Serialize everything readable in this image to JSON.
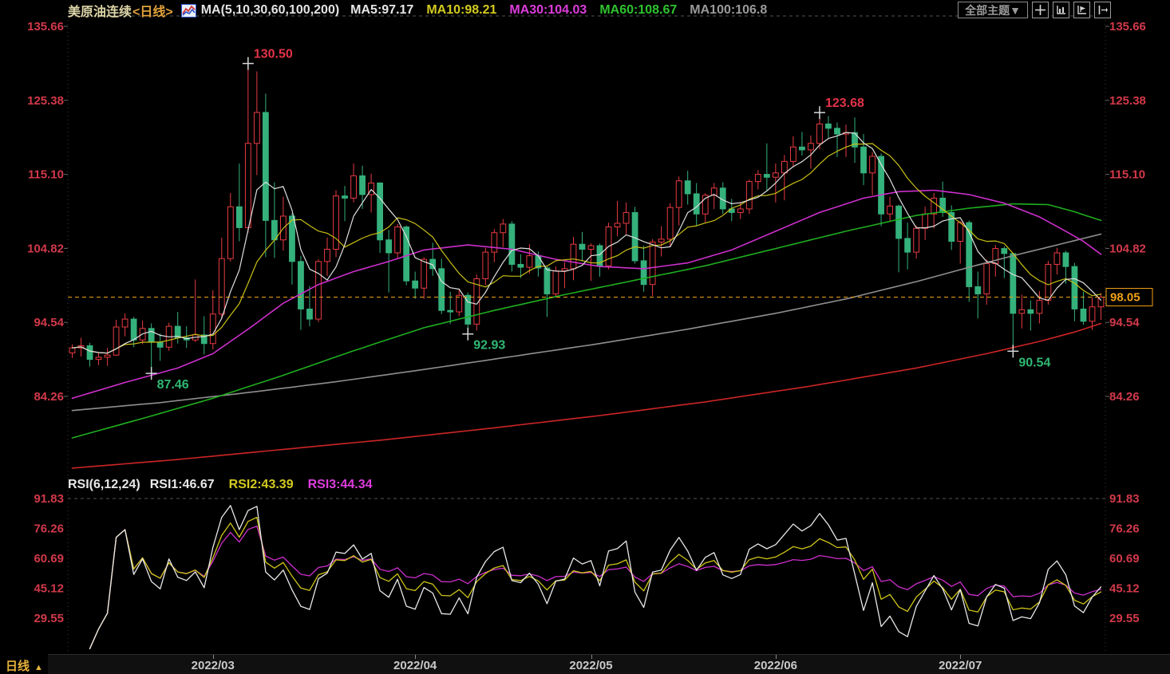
{
  "header": {
    "symbol": "美原油连续",
    "period": "<日线>",
    "ma_settings": "MA(5,10,30,60,100,200)",
    "ma_values": [
      {
        "key": "ma5",
        "label": "MA5:97.17",
        "color": "#e8e8e8"
      },
      {
        "key": "ma10",
        "label": "MA10:98.21",
        "color": "#d3cb21"
      },
      {
        "key": "ma30",
        "label": "MA30:104.03",
        "color": "#dd3ddd"
      },
      {
        "key": "ma60",
        "label": "MA60:108.67",
        "color": "#2fc32f"
      },
      {
        "key": "ma100",
        "label": "MA100:106.8",
        "color": "#9a9a9a"
      }
    ],
    "theme_button_label": "全部主题▼",
    "toolbar_icons": [
      "crosshair",
      "axis-scale",
      "axis-flag",
      "pan-right"
    ]
  },
  "rsi_header": {
    "title": "RSI(6,12,24)",
    "values": [
      {
        "key": "rsi1",
        "label": "RSI1:46.67",
        "color": "#e8e8e8"
      },
      {
        "key": "rsi2",
        "label": "RSI2:43.39",
        "color": "#d3cb21"
      },
      {
        "key": "rsi3",
        "label": "RSI3:44.34",
        "color": "#dd3ddd"
      }
    ]
  },
  "time_axis": {
    "period_label": "日线",
    "arrow": "▲"
  },
  "chart_data": {
    "type": "candlestick",
    "title": "美原油连续 日线",
    "price_axis_ticks": [
      135.66,
      125.38,
      115.1,
      104.82,
      94.54,
      84.26
    ],
    "rsi_axis_ticks": [
      91.83,
      76.26,
      60.69,
      45.12,
      29.55
    ],
    "last_price": 98.05,
    "months": [
      {
        "index": 16,
        "label": "2022/03"
      },
      {
        "index": 39,
        "label": "2022/04"
      },
      {
        "index": 59,
        "label": "2022/05"
      },
      {
        "index": 80,
        "label": "2022/06"
      },
      {
        "index": 101,
        "label": "2022/07"
      }
    ],
    "candles": [
      [
        90.3,
        91.5,
        89.6,
        91.0
      ],
      [
        91.0,
        92.4,
        89.8,
        91.3
      ],
      [
        91.3,
        91.7,
        88.4,
        89.4
      ],
      [
        89.4,
        90.4,
        88.6,
        89.7
      ],
      [
        89.7,
        91.0,
        88.5,
        90.0
      ],
      [
        90.0,
        94.9,
        89.9,
        93.9
      ],
      [
        93.9,
        95.8,
        92.6,
        95.0
      ],
      [
        95.0,
        95.3,
        91.1,
        92.1
      ],
      [
        92.1,
        94.8,
        91.5,
        93.7
      ],
      [
        93.7,
        94.4,
        87.46,
        91.8
      ],
      [
        91.8,
        93.0,
        89.2,
        91.1
      ],
      [
        91.1,
        94.5,
        90.6,
        94.0
      ],
      [
        94.0,
        96.0,
        91.6,
        92.4
      ],
      [
        92.4,
        94.0,
        91.0,
        92.1
      ],
      [
        92.1,
        100.5,
        91.8,
        92.8
      ],
      [
        92.8,
        95.4,
        90.1,
        91.6
      ],
      [
        91.6,
        99.0,
        90.8,
        95.7
      ],
      [
        95.7,
        106.3,
        95.0,
        103.4
      ],
      [
        103.4,
        112.5,
        103.0,
        110.6
      ],
      [
        110.6,
        116.6,
        105.8,
        107.7
      ],
      [
        107.7,
        130.5,
        107.0,
        119.4
      ],
      [
        119.4,
        129.4,
        115.0,
        123.7
      ],
      [
        123.7,
        126.3,
        103.6,
        108.7
      ],
      [
        108.7,
        114.0,
        103.5,
        106.0
      ],
      [
        106.0,
        112.0,
        104.5,
        109.3
      ],
      [
        109.3,
        109.7,
        99.8,
        103.0
      ],
      [
        103.0,
        103.8,
        93.5,
        96.4
      ],
      [
        96.4,
        99.6,
        94.0,
        95.0
      ],
      [
        95.0,
        103.3,
        94.6,
        103.0
      ],
      [
        103.0,
        106.3,
        101.0,
        104.7
      ],
      [
        104.7,
        112.9,
        103.6,
        112.1
      ],
      [
        112.1,
        113.5,
        108.6,
        111.8
      ],
      [
        111.8,
        116.6,
        111.2,
        114.9
      ],
      [
        114.9,
        116.3,
        110.3,
        112.3
      ],
      [
        112.3,
        115.2,
        109.8,
        113.9
      ],
      [
        113.9,
        114.0,
        104.2,
        106.0
      ],
      [
        106.0,
        107.4,
        98.7,
        104.2
      ],
      [
        104.2,
        108.2,
        103.5,
        107.8
      ],
      [
        107.8,
        108.0,
        99.7,
        100.3
      ],
      [
        100.3,
        101.6,
        97.8,
        99.3
      ],
      [
        99.3,
        103.6,
        97.8,
        103.3
      ],
      [
        103.3,
        105.6,
        101.0,
        102.0
      ],
      [
        102.0,
        103.4,
        95.7,
        96.2
      ],
      [
        96.2,
        98.8,
        94.3,
        96.0
      ],
      [
        96.0,
        99.1,
        95.4,
        98.3
      ],
      [
        98.3,
        98.7,
        92.93,
        94.3
      ],
      [
        94.3,
        101.2,
        93.4,
        100.6
      ],
      [
        100.6,
        104.9,
        99.7,
        104.3
      ],
      [
        104.3,
        107.5,
        102.9,
        107.0
      ],
      [
        107.0,
        108.9,
        105.0,
        108.2
      ],
      [
        108.2,
        108.6,
        101.6,
        102.6
      ],
      [
        102.6,
        104.0,
        100.7,
        102.2
      ],
      [
        102.2,
        105.4,
        101.3,
        103.8
      ],
      [
        103.8,
        104.4,
        100.9,
        102.1
      ],
      [
        102.1,
        102.3,
        95.3,
        98.5
      ],
      [
        98.5,
        102.3,
        98.0,
        101.7
      ],
      [
        101.7,
        102.9,
        99.3,
        102.0
      ],
      [
        102.0,
        106.4,
        100.4,
        105.4
      ],
      [
        105.4,
        107.1,
        103.0,
        104.7
      ],
      [
        104.7,
        105.5,
        100.3,
        105.2
      ],
      [
        105.2,
        105.5,
        100.9,
        102.4
      ],
      [
        102.4,
        108.4,
        101.9,
        107.8
      ],
      [
        107.8,
        111.4,
        106.5,
        108.3
      ],
      [
        108.3,
        111.2,
        106.8,
        109.8
      ],
      [
        109.8,
        110.6,
        102.7,
        103.1
      ],
      [
        103.1,
        105.2,
        98.8,
        99.8
      ],
      [
        99.8,
        106.1,
        98.2,
        105.7
      ],
      [
        105.7,
        107.9,
        103.7,
        106.1
      ],
      [
        106.1,
        111.1,
        105.1,
        110.5
      ],
      [
        110.5,
        114.8,
        108.0,
        114.2
      ],
      [
        114.2,
        115.6,
        110.9,
        112.4
      ],
      [
        112.4,
        113.9,
        107.9,
        109.6
      ],
      [
        109.6,
        112.5,
        108.4,
        112.2
      ],
      [
        112.2,
        113.9,
        110.3,
        113.2
      ],
      [
        113.2,
        114.0,
        109.6,
        110.3
      ],
      [
        110.3,
        111.7,
        108.6,
        109.8
      ],
      [
        109.8,
        111.3,
        108.9,
        110.3
      ],
      [
        110.3,
        114.4,
        109.6,
        114.1
      ],
      [
        114.1,
        115.7,
        113.0,
        115.1
      ],
      [
        115.1,
        119.4,
        112.9,
        114.7
      ],
      [
        114.7,
        116.6,
        111.2,
        115.3
      ],
      [
        115.3,
        117.8,
        111.5,
        116.9
      ],
      [
        116.9,
        120.4,
        116.1,
        118.9
      ],
      [
        118.9,
        121.0,
        117.7,
        118.5
      ],
      [
        118.5,
        120.5,
        115.9,
        119.4
      ],
      [
        119.4,
        123.68,
        118.6,
        122.1
      ],
      [
        122.1,
        123.2,
        120.2,
        121.5
      ],
      [
        121.5,
        122.3,
        117.5,
        120.7
      ],
      [
        120.7,
        122.0,
        117.5,
        120.9
      ],
      [
        120.9,
        123.0,
        116.7,
        118.9
      ],
      [
        118.9,
        120.7,
        113.6,
        115.3
      ],
      [
        115.3,
        118.2,
        112.2,
        117.6
      ],
      [
        117.6,
        118.0,
        107.9,
        109.6
      ],
      [
        109.6,
        112.0,
        108.5,
        110.7
      ],
      [
        110.7,
        110.9,
        101.5,
        106.2
      ],
      [
        106.2,
        108.4,
        101.9,
        104.3
      ],
      [
        104.3,
        108.0,
        103.4,
        107.6
      ],
      [
        107.6,
        110.6,
        106.0,
        109.6
      ],
      [
        109.6,
        112.5,
        107.6,
        111.8
      ],
      [
        111.8,
        114.1,
        109.2,
        109.8
      ],
      [
        109.8,
        110.8,
        104.6,
        105.8
      ],
      [
        105.8,
        108.6,
        102.7,
        108.4
      ],
      [
        108.4,
        108.7,
        97.4,
        99.5
      ],
      [
        99.5,
        101.6,
        95.1,
        98.5
      ],
      [
        98.5,
        103.3,
        97.0,
        102.7
      ],
      [
        102.7,
        105.3,
        100.9,
        104.8
      ],
      [
        104.8,
        105.1,
        100.7,
        104.1
      ],
      [
        104.1,
        104.2,
        90.54,
        95.8
      ],
      [
        95.8,
        98.4,
        93.7,
        96.3
      ],
      [
        96.3,
        97.6,
        93.4,
        95.8
      ],
      [
        95.8,
        98.9,
        94.4,
        97.6
      ],
      [
        97.6,
        103.1,
        97.0,
        102.6
      ],
      [
        102.6,
        104.9,
        101.2,
        104.2
      ],
      [
        104.2,
        104.5,
        99.9,
        102.3
      ],
      [
        102.3,
        102.8,
        94.7,
        96.4
      ],
      [
        96.4,
        98.8,
        94.2,
        94.7
      ],
      [
        94.7,
        98.0,
        93.5,
        96.7
      ],
      [
        96.7,
        98.6,
        94.9,
        98.05
      ]
    ],
    "computed_ma": [
      {
        "period": 5,
        "color": "#e0e0e0"
      },
      {
        "period": 10,
        "color": "#c9c014"
      }
    ],
    "overlays": [
      {
        "name": "ma30",
        "color": "#cc2fcc",
        "points": [
          [
            0,
            84.0
          ],
          [
            6,
            86.2
          ],
          [
            12,
            88.2
          ],
          [
            16,
            90.2
          ],
          [
            20,
            93.6
          ],
          [
            24,
            97.2
          ],
          [
            28,
            99.8
          ],
          [
            32,
            101.6
          ],
          [
            36,
            103.0
          ],
          [
            40,
            104.6
          ],
          [
            45,
            105.3
          ],
          [
            50,
            104.7
          ],
          [
            55,
            103.3
          ],
          [
            60,
            102.3
          ],
          [
            65,
            102.0
          ],
          [
            70,
            102.8
          ],
          [
            75,
            104.6
          ],
          [
            80,
            107.2
          ],
          [
            85,
            109.8
          ],
          [
            90,
            111.8
          ],
          [
            94,
            112.7
          ],
          [
            98,
            112.9
          ],
          [
            102,
            112.3
          ],
          [
            106,
            111.1
          ],
          [
            110,
            109.2
          ],
          [
            113,
            107.2
          ],
          [
            115,
            105.8
          ],
          [
            117,
            104.0
          ]
        ]
      },
      {
        "name": "ma60",
        "color": "#1fae1f",
        "points": [
          [
            0,
            78.5
          ],
          [
            8,
            81.2
          ],
          [
            16,
            84.0
          ],
          [
            24,
            87.2
          ],
          [
            32,
            90.6
          ],
          [
            40,
            93.8
          ],
          [
            48,
            96.2
          ],
          [
            56,
            98.4
          ],
          [
            64,
            100.4
          ],
          [
            72,
            102.4
          ],
          [
            80,
            104.8
          ],
          [
            88,
            107.2
          ],
          [
            96,
            109.4
          ],
          [
            102,
            110.4
          ],
          [
            107,
            111.0
          ],
          [
            111,
            110.9
          ],
          [
            114,
            109.9
          ],
          [
            117,
            108.7
          ]
        ]
      },
      {
        "name": "ma100",
        "color": "#8f8f8f",
        "points": [
          [
            0,
            82.3
          ],
          [
            10,
            83.4
          ],
          [
            20,
            84.8
          ],
          [
            30,
            86.3
          ],
          [
            40,
            88.0
          ],
          [
            50,
            89.8
          ],
          [
            60,
            91.6
          ],
          [
            70,
            93.6
          ],
          [
            80,
            95.8
          ],
          [
            88,
            97.8
          ],
          [
            96,
            100.2
          ],
          [
            102,
            102.2
          ],
          [
            107,
            103.8
          ],
          [
            111,
            105.0
          ],
          [
            114,
            105.9
          ],
          [
            117,
            106.8
          ]
        ]
      },
      {
        "name": "ma200",
        "color": "#cc2525",
        "points": [
          [
            0,
            74.3
          ],
          [
            12,
            75.5
          ],
          [
            24,
            76.9
          ],
          [
            36,
            78.3
          ],
          [
            48,
            79.9
          ],
          [
            60,
            81.6
          ],
          [
            72,
            83.5
          ],
          [
            84,
            85.7
          ],
          [
            96,
            88.2
          ],
          [
            104,
            90.2
          ],
          [
            110,
            91.9
          ],
          [
            114,
            93.2
          ],
          [
            117,
            94.4
          ]
        ]
      }
    ],
    "rsi_series": [
      {
        "period": 6,
        "color": "#e8e8e8"
      },
      {
        "period": 12,
        "color": "#cfc518"
      },
      {
        "period": 24,
        "color": "#cc2fcc"
      }
    ],
    "annotations": [
      {
        "index": 20,
        "price": 130.5,
        "label": "130.50",
        "kind": "high"
      },
      {
        "index": 85,
        "price": 123.68,
        "label": "123.68",
        "kind": "high"
      },
      {
        "index": 9,
        "price": 87.46,
        "label": "87.46",
        "kind": "low"
      },
      {
        "index": 45,
        "price": 92.93,
        "label": "92.93",
        "kind": "low"
      },
      {
        "index": 107,
        "price": 90.54,
        "label": "90.54",
        "kind": "low"
      }
    ],
    "colors": {
      "up": "#e83b42",
      "down": "#35b17c",
      "axis_text": "#d2394a",
      "last_price": "#efa018",
      "annotation_high": "#e23348",
      "annotation_low": "#2fb873",
      "cross_marker": "#d8d8d8"
    }
  }
}
